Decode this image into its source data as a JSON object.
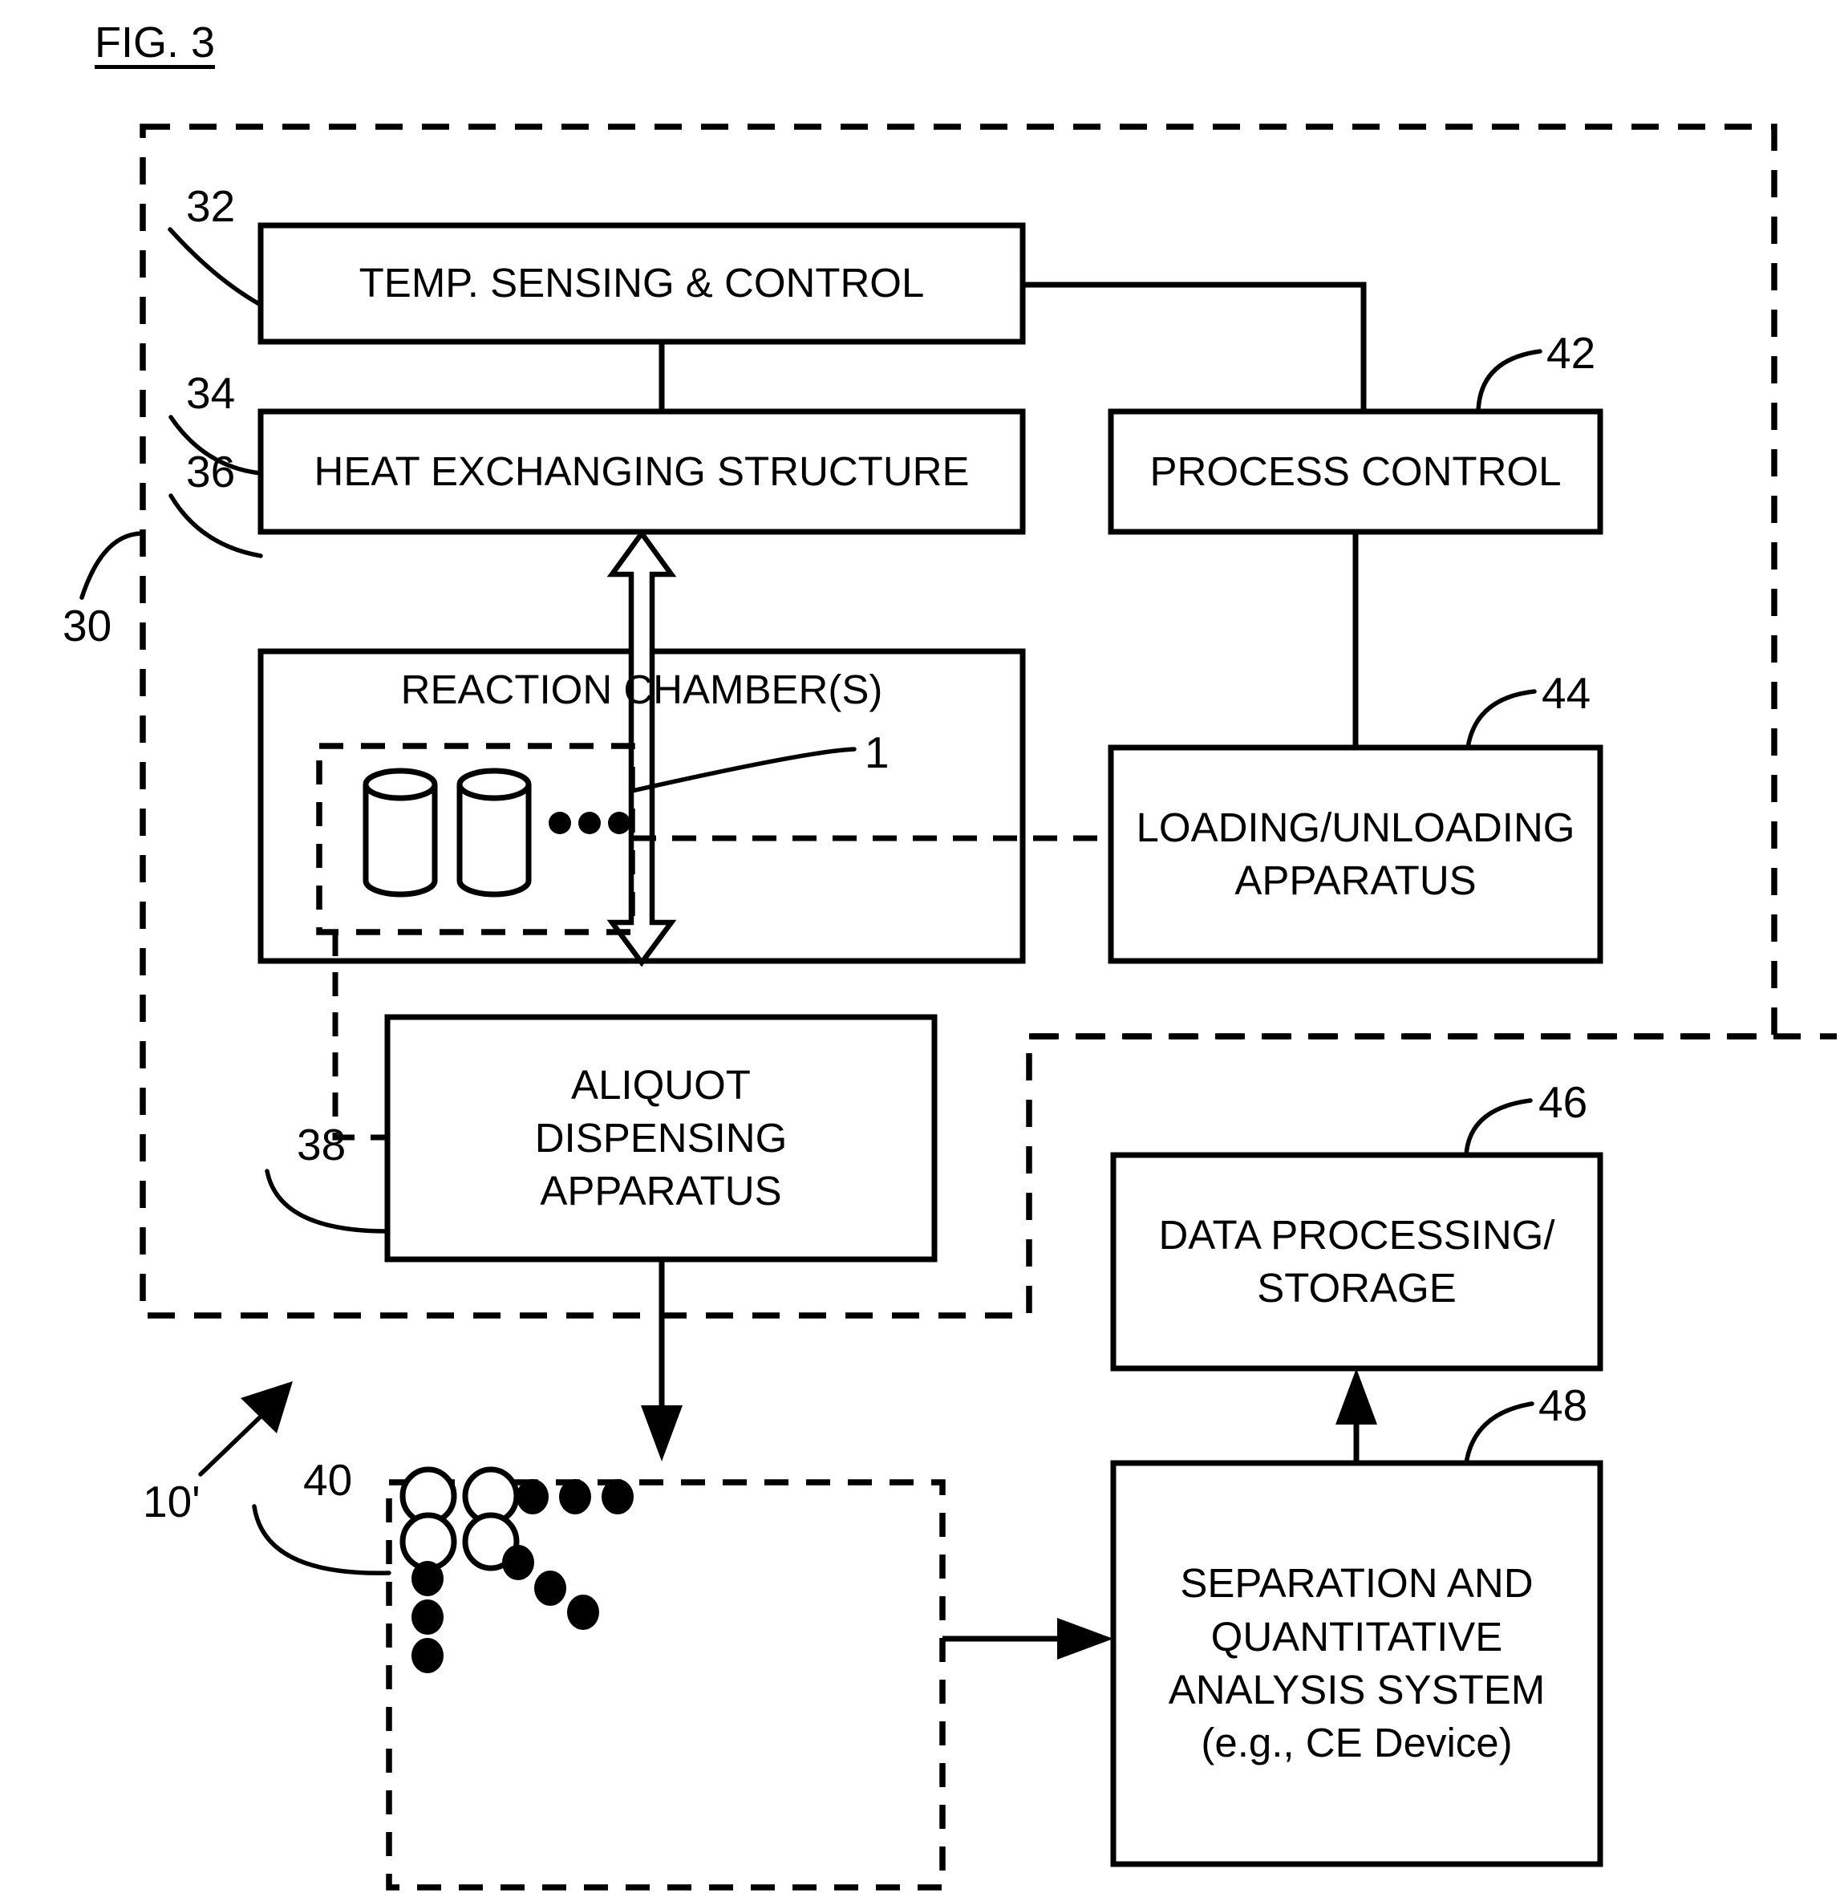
{
  "figure": {
    "title": "FIG. 3",
    "type": "patent-block-diagram"
  },
  "boxes": {
    "temp_sensing": "TEMP. SENSING & CONTROL",
    "heat_exchanging": "HEAT EXCHANGING STRUCTURE",
    "reaction_chamber": "REACTION CHAMBER(S)",
    "process_control": "PROCESS CONTROL",
    "loading_unloading": "LOADING/UNLOADING\nAPPARATUS",
    "aliquot_dispensing": "ALIQUOT\nDISPENSING\nAPPARATUS",
    "data_processing": "DATA PROCESSING/\nSTORAGE",
    "separation_analysis": "SEPARATION AND\nQUANTITATIVE\nANALYSIS SYSTEM\n(e.g., CE Device)"
  },
  "reference_numerals": {
    "system": "10'",
    "instrument_enclosure": "30",
    "temp_sensing": "32",
    "heat_exchanging": "34",
    "reaction_chamber": "36",
    "aliquot_dispensing": "38",
    "sample_array": "40",
    "process_control": "42",
    "loading_unloading": "44",
    "data_processing": "46",
    "separation_analysis": "48",
    "vial": "1"
  },
  "colors": {
    "line": "#000000",
    "background": "#ffffff",
    "fill": "#ffffff"
  },
  "reaction_chamber_contents": {
    "vial_count_shown": 2,
    "ellipsis_dots": 3,
    "note": "two cylindrical reaction vials inside a dashed boundary with an ellipsis"
  },
  "sample_array_contents": {
    "open_wells": 4,
    "filled_wells": 9,
    "note": "dashed boundary enclosing open circles and filled dots arranged in rows and a diagonal"
  }
}
